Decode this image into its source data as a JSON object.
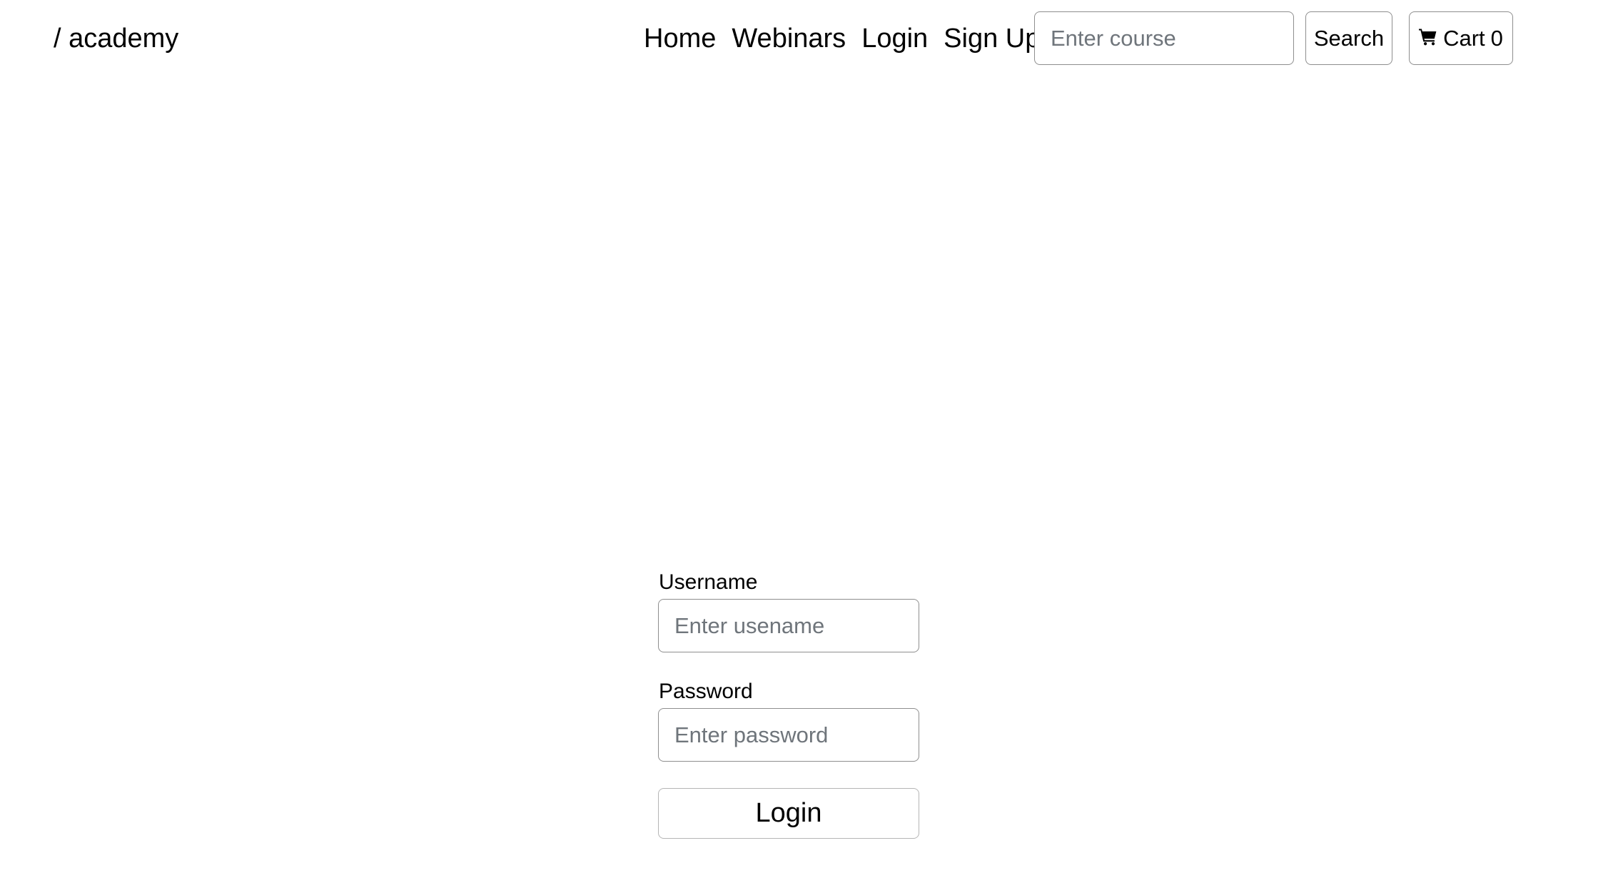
{
  "header": {
    "brand": "/ academy",
    "nav": [
      {
        "label": "Home"
      },
      {
        "label": "Webinars"
      },
      {
        "label": "Login"
      },
      {
        "label": "Sign Up"
      }
    ],
    "search": {
      "placeholder": "Enter course",
      "value": "",
      "button_label": "Search"
    },
    "cart": {
      "icon": "cart-icon",
      "label": "Cart",
      "count": "0"
    }
  },
  "login_form": {
    "username": {
      "label": "Username",
      "placeholder": "Enter usename",
      "value": ""
    },
    "password": {
      "label": "Password",
      "placeholder": "Enter password",
      "value": ""
    },
    "submit_label": "Login"
  }
}
